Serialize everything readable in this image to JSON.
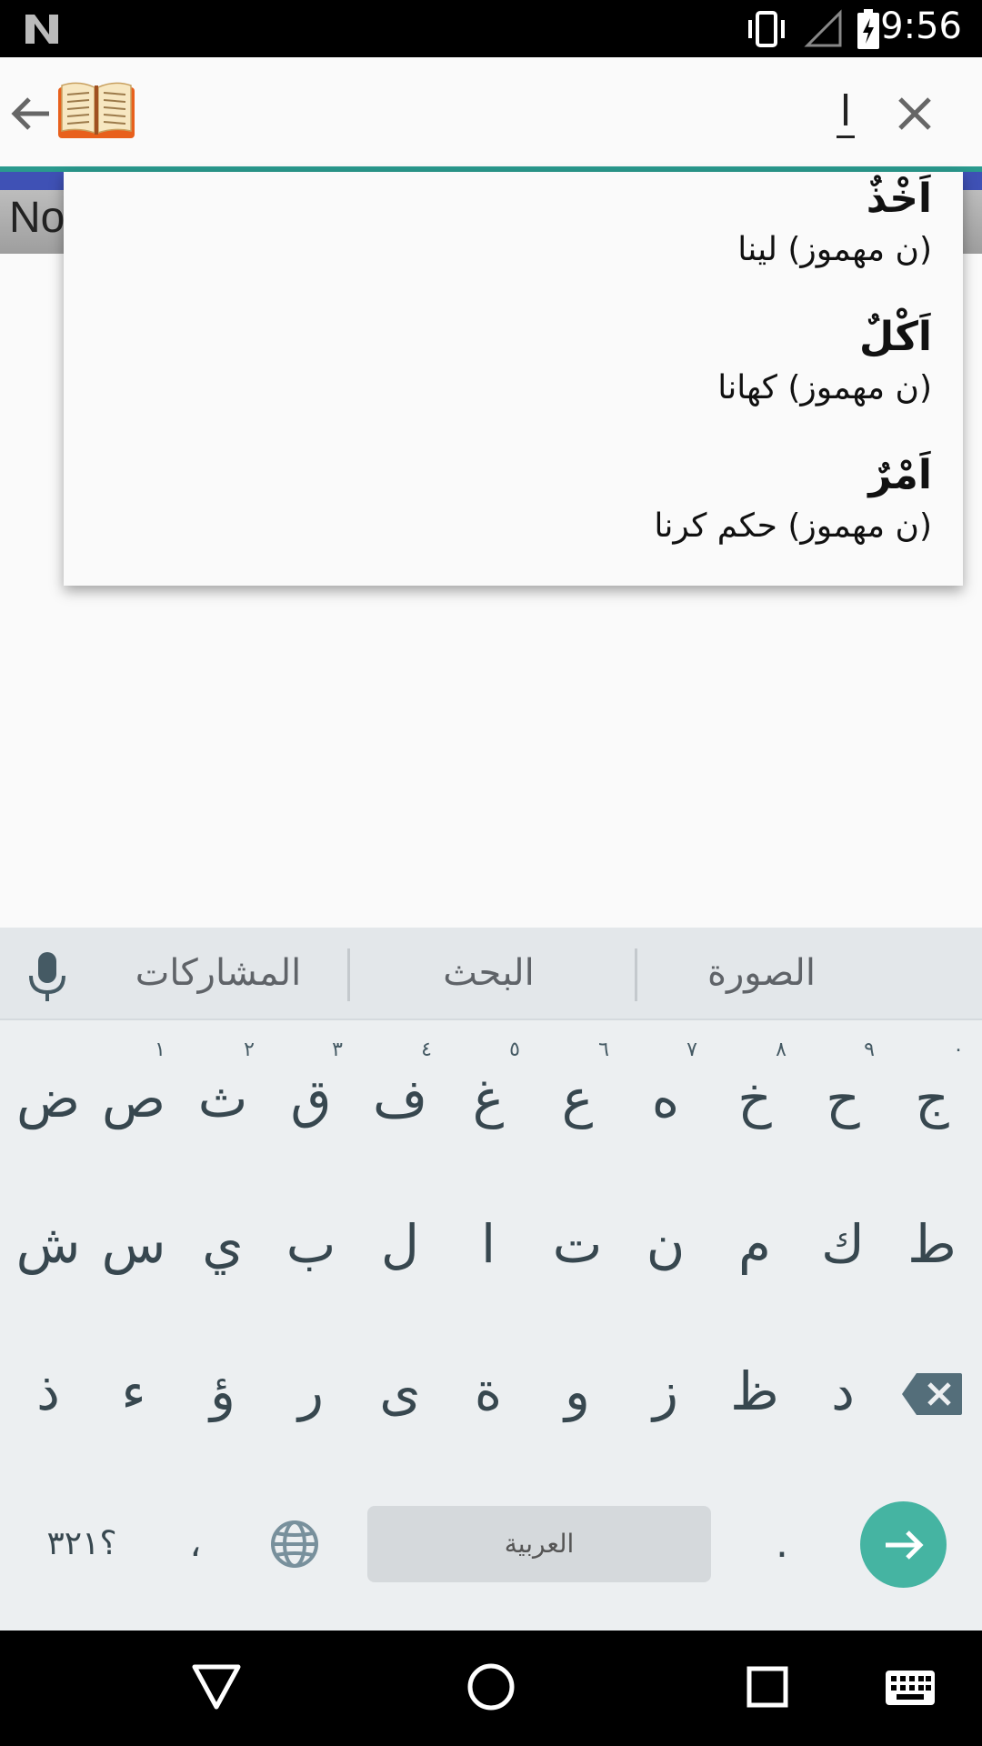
{
  "status_bar": {
    "time": "9:56"
  },
  "toolbar": {
    "query": "ا"
  },
  "background": {
    "partial_text": "No"
  },
  "suggestions": [
    {
      "word": "اَخْذٌ",
      "desc": "(ن مهموز) لينا"
    },
    {
      "word": "اَكْلٌ",
      "desc": "(ن مهموز) كهانا"
    },
    {
      "word": "اَمْرٌ",
      "desc": "(ن مهموز) حكم كرنا"
    }
  ],
  "keyboard": {
    "suggestion_words": [
      "الصورة",
      "البحث",
      "المشاركات"
    ],
    "row1": [
      {
        "k": "ج",
        "h": "٠"
      },
      {
        "k": "ح",
        "h": "٩"
      },
      {
        "k": "خ",
        "h": "٨"
      },
      {
        "k": "ه",
        "h": "٧"
      },
      {
        "k": "ع",
        "h": "٦"
      },
      {
        "k": "غ",
        "h": "٥"
      },
      {
        "k": "ف",
        "h": "٤"
      },
      {
        "k": "ق",
        "h": "٣"
      },
      {
        "k": "ث",
        "h": "٢"
      },
      {
        "k": "ص",
        "h": "١"
      },
      {
        "k": "ض",
        "h": ""
      }
    ],
    "row2": [
      "ط",
      "ك",
      "م",
      "ن",
      "ت",
      "ا",
      "ل",
      "ب",
      "ي",
      "س",
      "ش"
    ],
    "row3": [
      "د",
      "ظ",
      "ز",
      "و",
      "ة",
      "ى",
      "ر",
      "ؤ",
      "ء",
      "ذ"
    ],
    "symbols_key": "؟٣٢١",
    "comma_key": "،",
    "space_label": "العربية",
    "period_key": "."
  }
}
